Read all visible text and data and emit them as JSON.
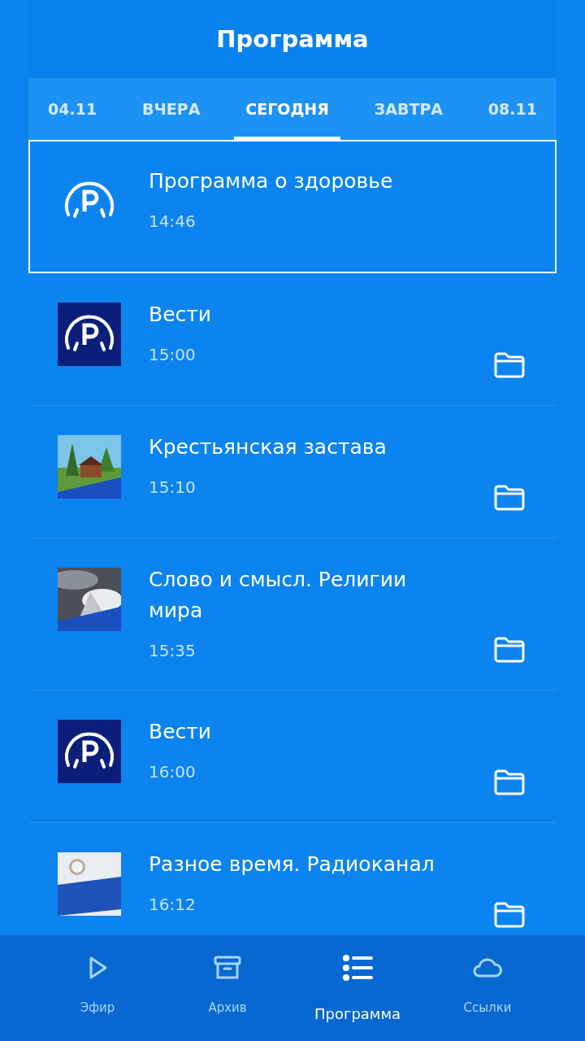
{
  "header": {
    "title": "Программа"
  },
  "tabs": [
    {
      "label": "04.11",
      "selected": false
    },
    {
      "label": "ВЧЕРА",
      "selected": false
    },
    {
      "label": "СЕГОДНЯ",
      "selected": true
    },
    {
      "label": "ЗАВТРА",
      "selected": false
    },
    {
      "label": "08.11",
      "selected": false
    }
  ],
  "programs": [
    {
      "title": "Программа о здоровье",
      "time": "14:46",
      "kind": "emblem",
      "selected": true,
      "archived": false
    },
    {
      "title": "Вести",
      "time": "15:00",
      "kind": "logo",
      "selected": false,
      "archived": true
    },
    {
      "title": "Крестьянская застава",
      "time": "15:10",
      "kind": "picture",
      "selected": false,
      "archived": true
    },
    {
      "title": "Слово и смысл. Религии мира",
      "time": "15:35",
      "kind": "picture",
      "selected": false,
      "archived": true
    },
    {
      "title": "Вести",
      "time": "16:00",
      "kind": "logo",
      "selected": false,
      "archived": true
    },
    {
      "title": "Разное время. Радиоканал",
      "time": "16:12",
      "kind": "picture",
      "selected": false,
      "archived": true
    }
  ],
  "bottom_nav": [
    {
      "label": "Эфир",
      "selected": false
    },
    {
      "label": "Архив",
      "selected": false
    },
    {
      "label": "Программа",
      "selected": true
    },
    {
      "label": "Ссылки",
      "selected": false
    }
  ]
}
